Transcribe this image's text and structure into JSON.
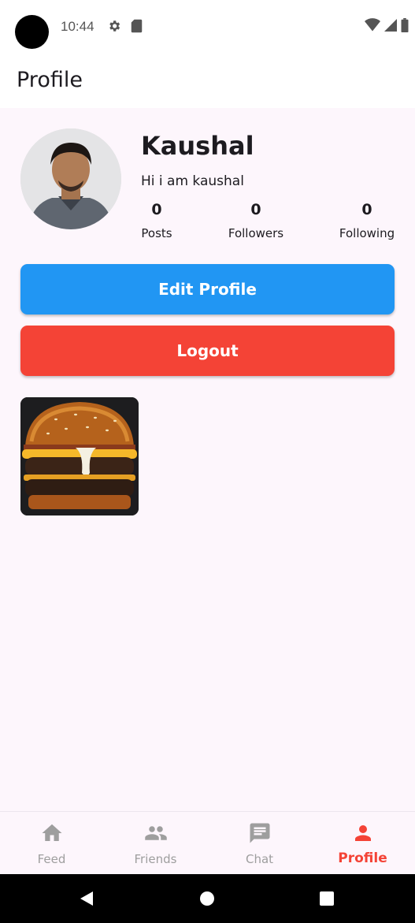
{
  "status_bar": {
    "time": "10:44",
    "icons": [
      "gear-icon",
      "sd-card-icon",
      "wifi-icon",
      "signal-icon",
      "battery-icon"
    ]
  },
  "app_bar": {
    "title": "Profile"
  },
  "profile": {
    "name": "Kaushal",
    "bio": "Hi i am kaushal",
    "stats": {
      "posts_count": "0",
      "posts_label": "Posts",
      "followers_count": "0",
      "followers_label": "Followers",
      "following_count": "0",
      "following_label": "Following"
    }
  },
  "actions": {
    "edit_label": "Edit Profile",
    "logout_label": "Logout"
  },
  "colors": {
    "edit_button": "#2196f3",
    "logout_button": "#f44336",
    "active_nav": "#f44336",
    "inactive_nav": "#9e9e9e",
    "background": "#fdf6fc"
  },
  "bottom_nav": {
    "items": [
      {
        "label": "Feed",
        "icon": "home-icon",
        "active": false
      },
      {
        "label": "Friends",
        "icon": "people-icon",
        "active": false
      },
      {
        "label": "Chat",
        "icon": "chat-icon",
        "active": false
      },
      {
        "label": "Profile",
        "icon": "person-icon",
        "active": true
      }
    ]
  },
  "system_nav": {
    "icons": [
      "back-icon",
      "home-circle-icon",
      "recents-icon"
    ]
  }
}
